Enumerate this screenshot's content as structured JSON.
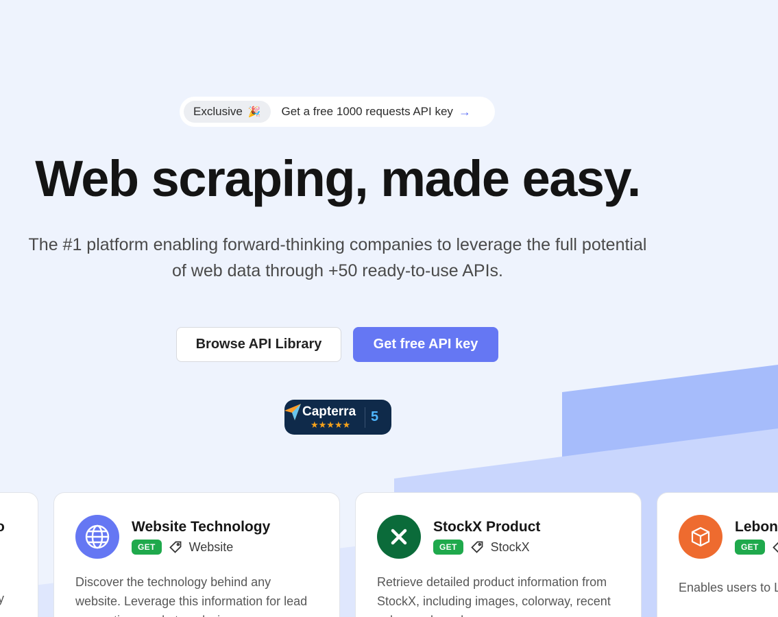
{
  "announcement": {
    "tag": "Exclusive",
    "tag_emoji": "🎉",
    "text": "Get a free 1000 requests API key",
    "arrow": "→"
  },
  "hero": {
    "title": "Web scraping, made easy.",
    "subtitle": "The #1 platform enabling forward-thinking companies to leverage the full potential of web data through +50 ready-to-use APIs."
  },
  "buttons": {
    "browse": "Browse API Library",
    "get_key": "Get free API key"
  },
  "capterra": {
    "name": "Capterra",
    "stars": "★★★★★",
    "score": "5"
  },
  "cards": {
    "left_partial": {
      "title_fragment": "fo",
      "desc_fragment": "ny"
    },
    "items": [
      {
        "icon": "globe-icon",
        "icon_color": "#6577f3",
        "title": "Website Technology",
        "method": "GET",
        "category": "Website",
        "description": "Discover the technology behind any website. Leverage this information for lead generation, market analysis"
      },
      {
        "icon": "x-icon",
        "icon_color": "#0b6b3a",
        "title": "StockX Product",
        "method": "GET",
        "category": "StockX",
        "description": "Retrieve detailed product information from StockX, including images, colorway, recent sales, and purchase"
      },
      {
        "icon": "cube-icon",
        "icon_color": "#ee6b2f",
        "title": "Lebonc",
        "method": "GET",
        "category": "",
        "description": "Enables users to Leboncoin, the le"
      }
    ]
  },
  "colors": {
    "background": "#eef3fd",
    "accent": "#6577f3",
    "get_badge": "#1fa94c",
    "band_dark": "#a6bcfb",
    "band_light": "#c9d6fd"
  }
}
